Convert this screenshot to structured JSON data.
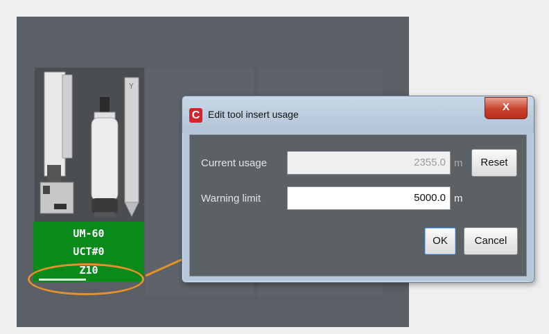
{
  "tool": {
    "model": "UM-60",
    "holder": "UCT#0",
    "slot": "Z10",
    "usage_fraction": 0.47
  },
  "dialog": {
    "title": "Edit tool insert usage",
    "close_label": "X",
    "app_icon_glyph": "C",
    "current_usage": {
      "label": "Current usage",
      "value": "2355.0",
      "unit": "m",
      "reset_label": "Reset"
    },
    "warning_limit": {
      "label": "Warning limit",
      "value": "5000.0",
      "unit": "m"
    },
    "ok_label": "OK",
    "cancel_label": "Cancel"
  },
  "colors": {
    "tool_label_green": "#0a8a1b",
    "highlight_orange": "#e8902a",
    "close_red": "#c9412b",
    "app_icon_red": "#d7242a"
  },
  "icons": {
    "app_icon": "cam-app-logo-icon",
    "close": "close-icon"
  }
}
